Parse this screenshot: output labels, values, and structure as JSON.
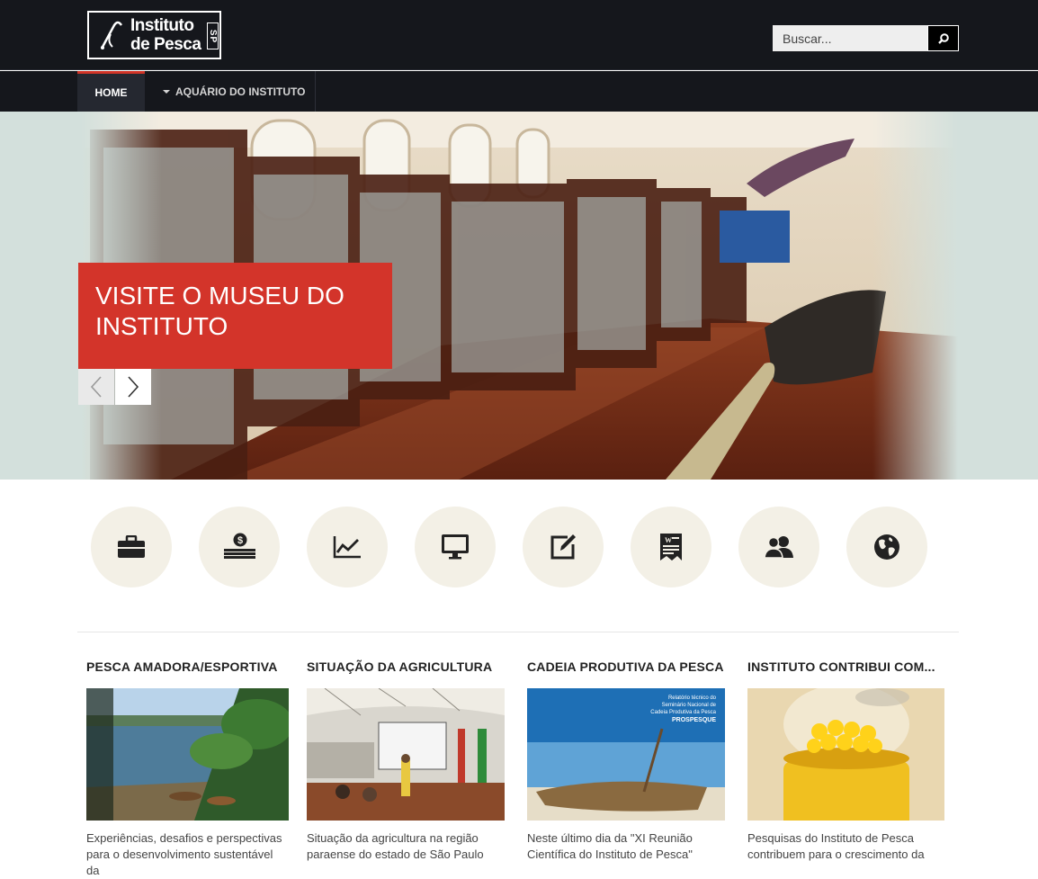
{
  "header": {
    "logo_line1": "Instituto",
    "logo_line2": "de Pesca",
    "logo_badge": "SP",
    "search_placeholder": "Buscar..."
  },
  "nav": {
    "home": "HOME",
    "aquario": "AQUÁRIO DO INSTITUTO"
  },
  "slider": {
    "caption": "VISITE O MUSEU DO INSTITUTO"
  },
  "icons": [
    "briefcase-icon",
    "money-icon",
    "chart-icon",
    "monitor-icon",
    "edit-icon",
    "document-icon",
    "users-icon",
    "globe-icon"
  ],
  "news": [
    {
      "title": "PESCA AMADORA/ESPORTIVA",
      "text": "Experiências, desafios e perspectivas para o desenvolvimento sustentável da"
    },
    {
      "title": "SITUAÇÃO DA AGRICULTURA",
      "text": "Situação da agricultura na região paraense do estado de São Paulo"
    },
    {
      "title": "CADEIA PRODUTIVA DA PESCA",
      "text": "Neste último dia da \"XI Reunião Científica do Instituto de Pesca\""
    },
    {
      "title": "INSTITUTO CONTRIBUI COM...",
      "text": "Pesquisas do Instituto de Pesca contribuem para o crescimento da"
    }
  ],
  "colors": {
    "topbar": "#15171c",
    "accent": "#d3342a",
    "icon_circle": "#f3f0e6"
  }
}
